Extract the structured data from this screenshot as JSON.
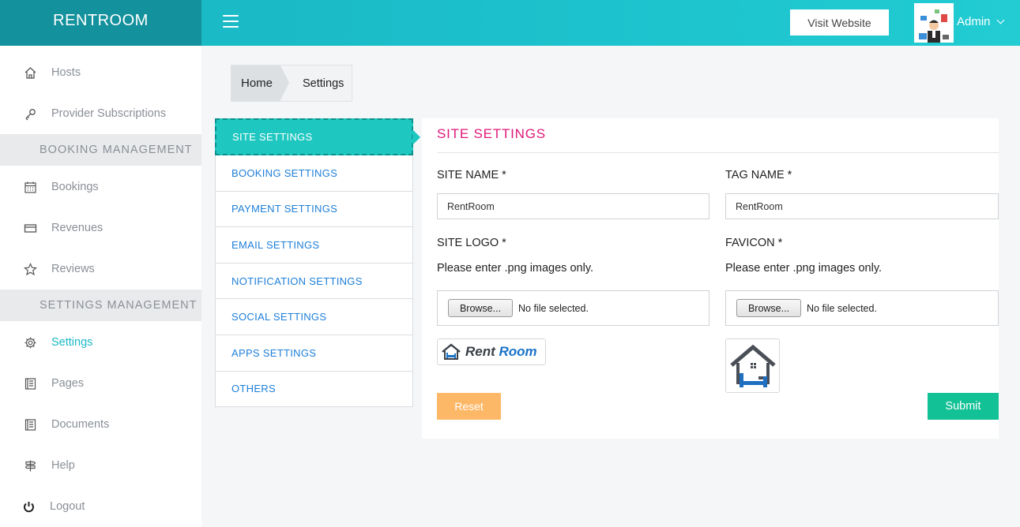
{
  "header": {
    "brand": "RENTROOM",
    "visit_website": "Visit Website",
    "user_name": "Admin"
  },
  "sidebar": {
    "items_top": [
      {
        "label": "Hosts",
        "icon": "home-icon"
      },
      {
        "label": "Provider Subscriptions",
        "icon": "key-icon"
      }
    ],
    "booking_header": "BOOKING MANAGEMENT",
    "items_booking": [
      {
        "label": "Bookings",
        "icon": "calendar-icon"
      },
      {
        "label": "Revenues",
        "icon": "credit-card-icon"
      },
      {
        "label": "Reviews",
        "icon": "star-icon"
      }
    ],
    "settings_header": "SETTINGS MANAGEMENT",
    "items_settings": [
      {
        "label": "Settings",
        "icon": "gear-icon",
        "active": true
      },
      {
        "label": "Pages",
        "icon": "book-icon"
      },
      {
        "label": "Documents",
        "icon": "book-icon"
      },
      {
        "label": "Help",
        "icon": "signpost-icon"
      },
      {
        "label": "Logout",
        "icon": "power-icon"
      }
    ]
  },
  "breadcrumb": {
    "home": "Home",
    "current": "Settings"
  },
  "tabs": [
    "SITE SETTINGS",
    "BOOKING SETTINGS",
    "PAYMENT SETTINGS",
    "EMAIL SETTINGS",
    "NOTIFICATION SETTINGS",
    "SOCIAL SETTINGS",
    "APPS SETTINGS",
    "OTHERS"
  ],
  "panel": {
    "title": "SITE SETTINGS",
    "site_name_label": "SITE NAME *",
    "site_name_value": "RentRoom",
    "tag_name_label": "TAG NAME *",
    "tag_name_value": "RentRoom",
    "site_logo_label": "SITE LOGO *",
    "site_logo_hint": "Please enter .png images only.",
    "favicon_label": "FAVICON *",
    "favicon_hint": "Please enter .png images only.",
    "browse_label": "Browse...",
    "no_file": "No file selected.",
    "logo_word1": "Rent",
    "logo_word2": "Room",
    "reset": "Reset",
    "submit": "Submit"
  },
  "colors": {
    "accent": "#1bb8c4",
    "tab_active": "#1fc7c1",
    "title_pink": "#e0197a",
    "reset": "#fdb867",
    "submit": "#12c196"
  }
}
